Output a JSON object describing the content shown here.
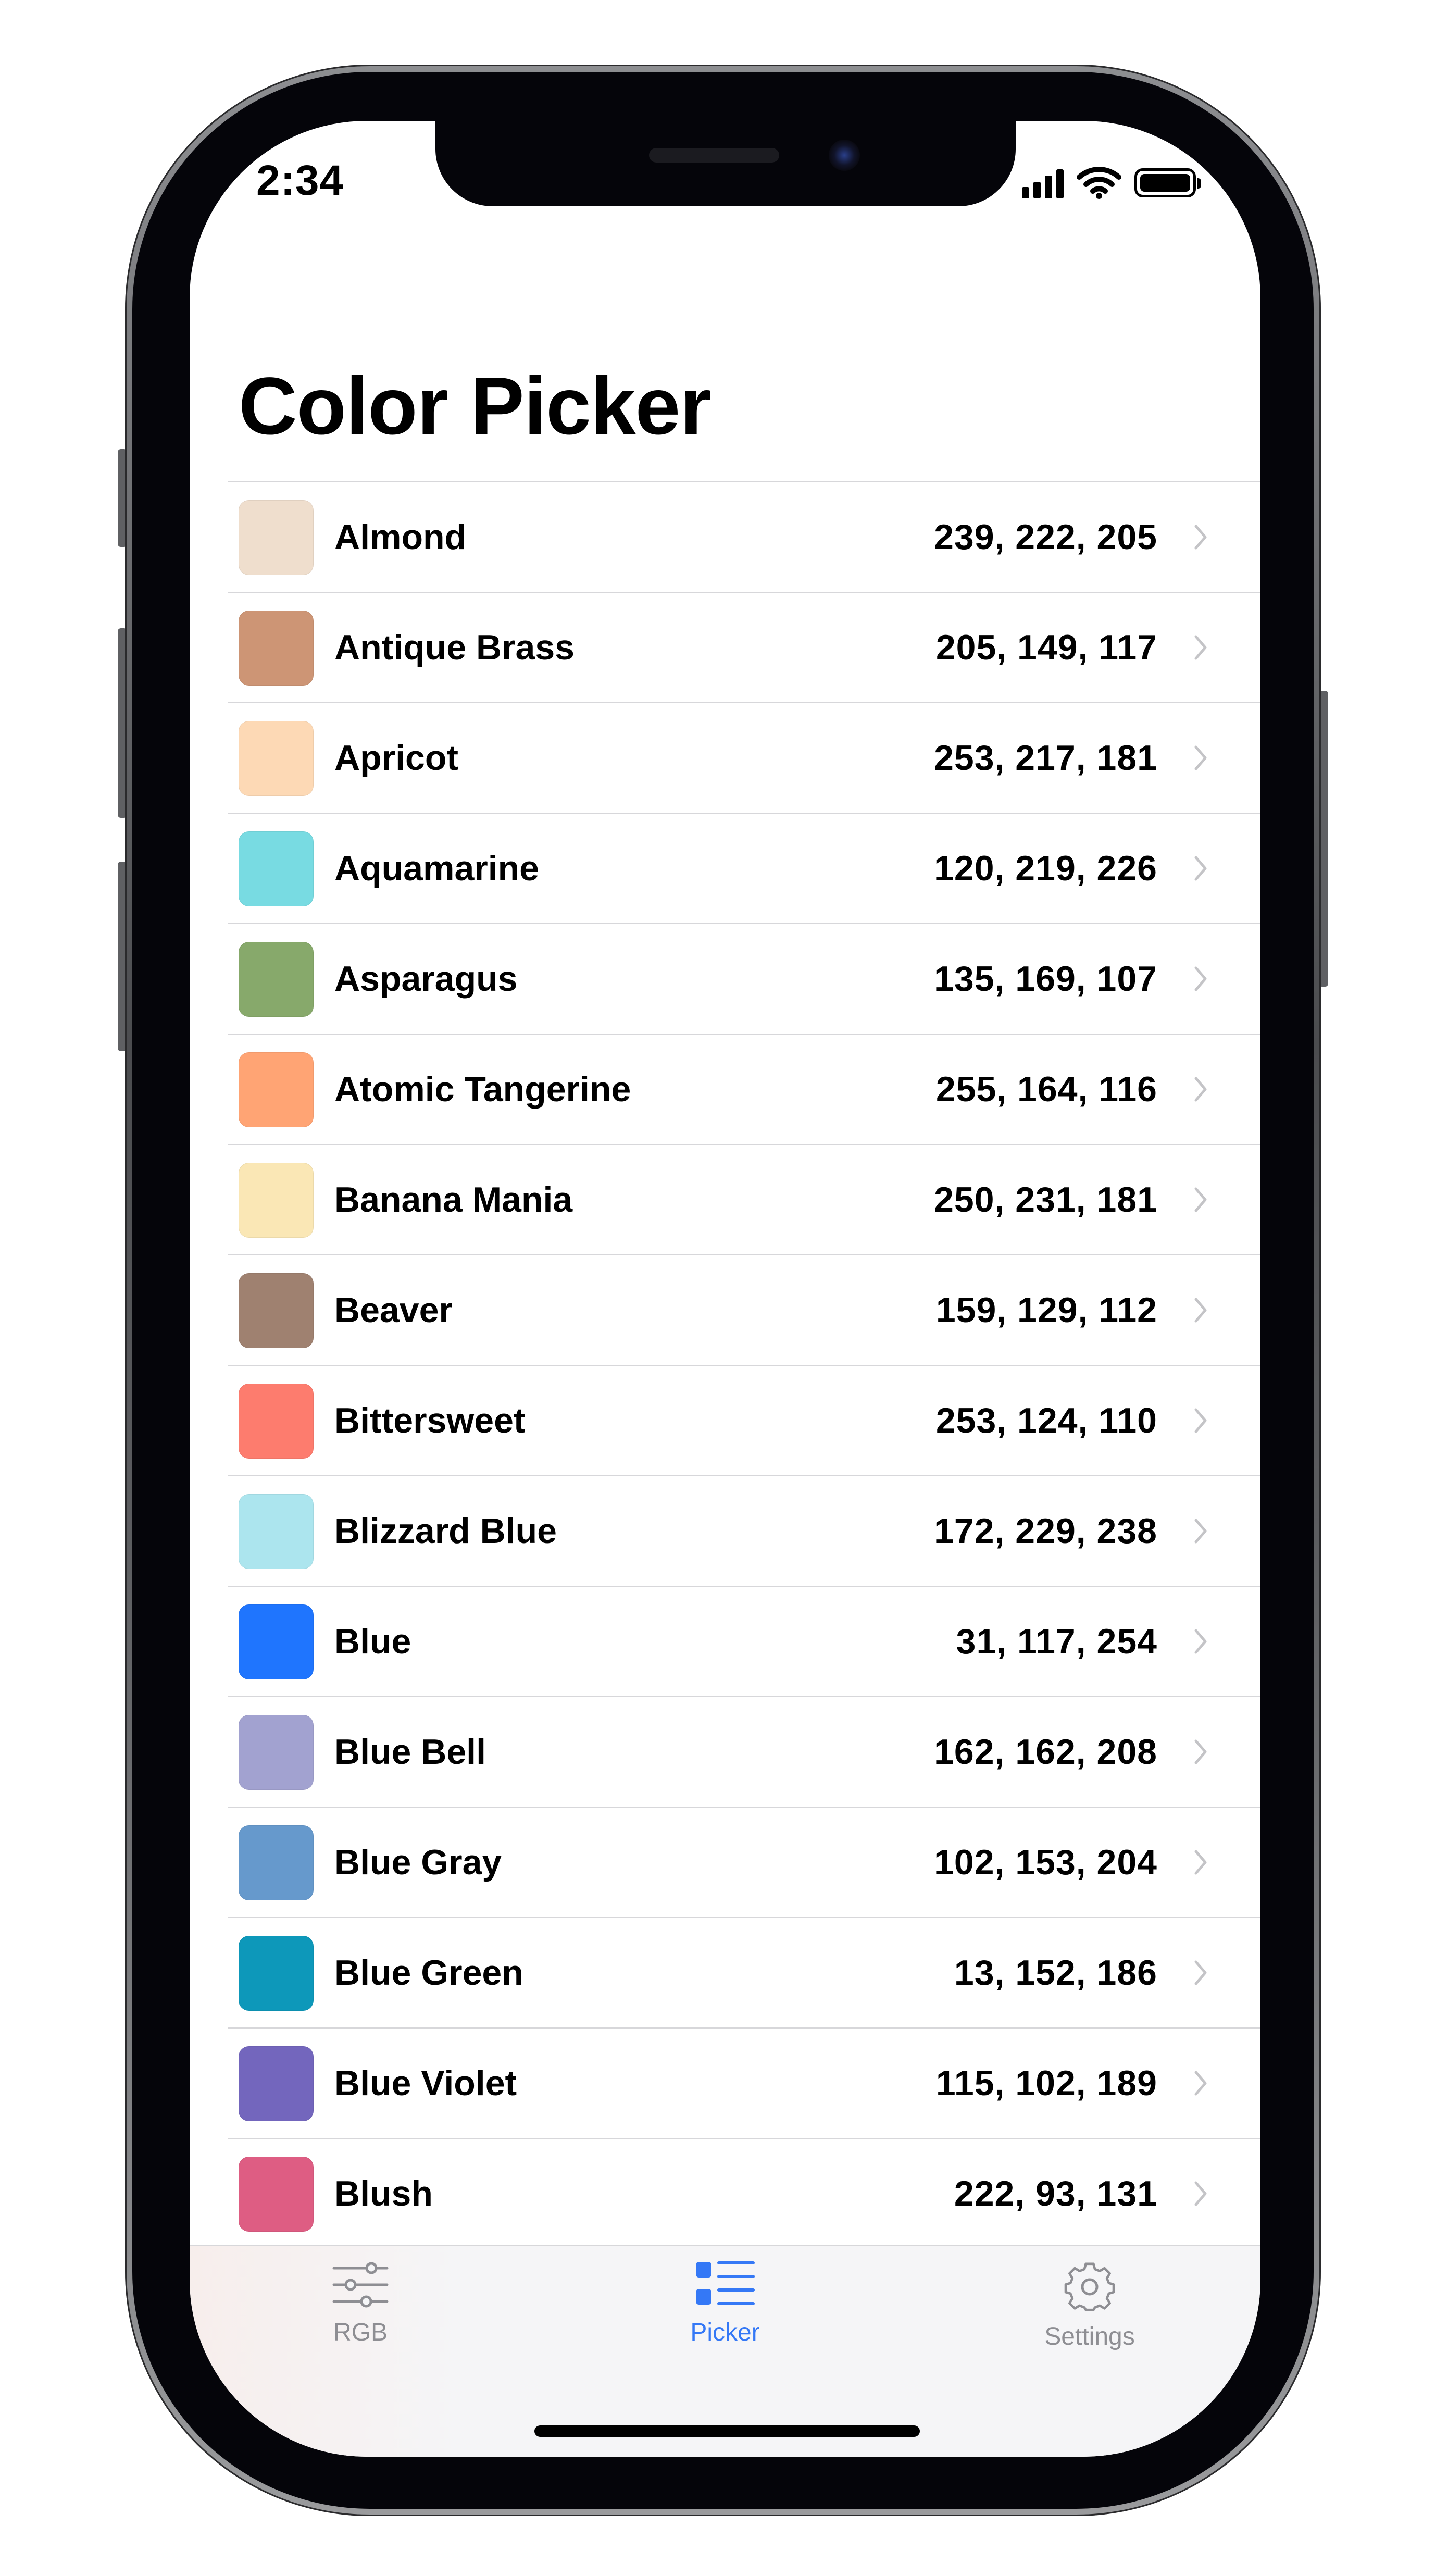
{
  "status_bar": {
    "time": "2:34"
  },
  "header": {
    "title": "Color Picker"
  },
  "colors": [
    {
      "name": "Almond",
      "rgb": "239, 222, 205",
      "swatch": "#efdecd"
    },
    {
      "name": "Antique Brass",
      "rgb": "205, 149, 117",
      "swatch": "#cd9575"
    },
    {
      "name": "Apricot",
      "rgb": "253, 217, 181",
      "swatch": "#fdd9b5"
    },
    {
      "name": "Aquamarine",
      "rgb": "120, 219, 226",
      "swatch": "#78dbe2"
    },
    {
      "name": "Asparagus",
      "rgb": "135, 169, 107",
      "swatch": "#87a96b"
    },
    {
      "name": "Atomic Tangerine",
      "rgb": "255, 164, 116",
      "swatch": "#ffa474"
    },
    {
      "name": "Banana Mania",
      "rgb": "250, 231, 181",
      "swatch": "#fae7b5"
    },
    {
      "name": "Beaver",
      "rgb": "159, 129, 112",
      "swatch": "#9f8170"
    },
    {
      "name": "Bittersweet",
      "rgb": "253, 124, 110",
      "swatch": "#fd7c6e"
    },
    {
      "name": "Blizzard Blue",
      "rgb": "172, 229, 238",
      "swatch": "#ace5ee"
    },
    {
      "name": "Blue",
      "rgb": "31, 117, 254",
      "swatch": "#1f75fe"
    },
    {
      "name": "Blue Bell",
      "rgb": "162, 162, 208",
      "swatch": "#a2a2d0"
    },
    {
      "name": "Blue Gray",
      "rgb": "102, 153, 204",
      "swatch": "#6699cc"
    },
    {
      "name": "Blue Green",
      "rgb": "13, 152, 186",
      "swatch": "#0d98ba"
    },
    {
      "name": "Blue Violet",
      "rgb": "115, 102, 189",
      "swatch": "#7366bd"
    },
    {
      "name": "Blush",
      "rgb": "222, 93, 131",
      "swatch": "#de5d83"
    }
  ],
  "tabs": [
    {
      "label": "RGB",
      "icon": "sliders-icon",
      "selected": false
    },
    {
      "label": "Picker",
      "icon": "list-icon",
      "selected": true
    },
    {
      "label": "Settings",
      "icon": "gear-icon",
      "selected": false
    }
  ],
  "theme": {
    "accent": "#3478f6",
    "inactive": "#8e8e93",
    "separator": "#d7d7da"
  }
}
